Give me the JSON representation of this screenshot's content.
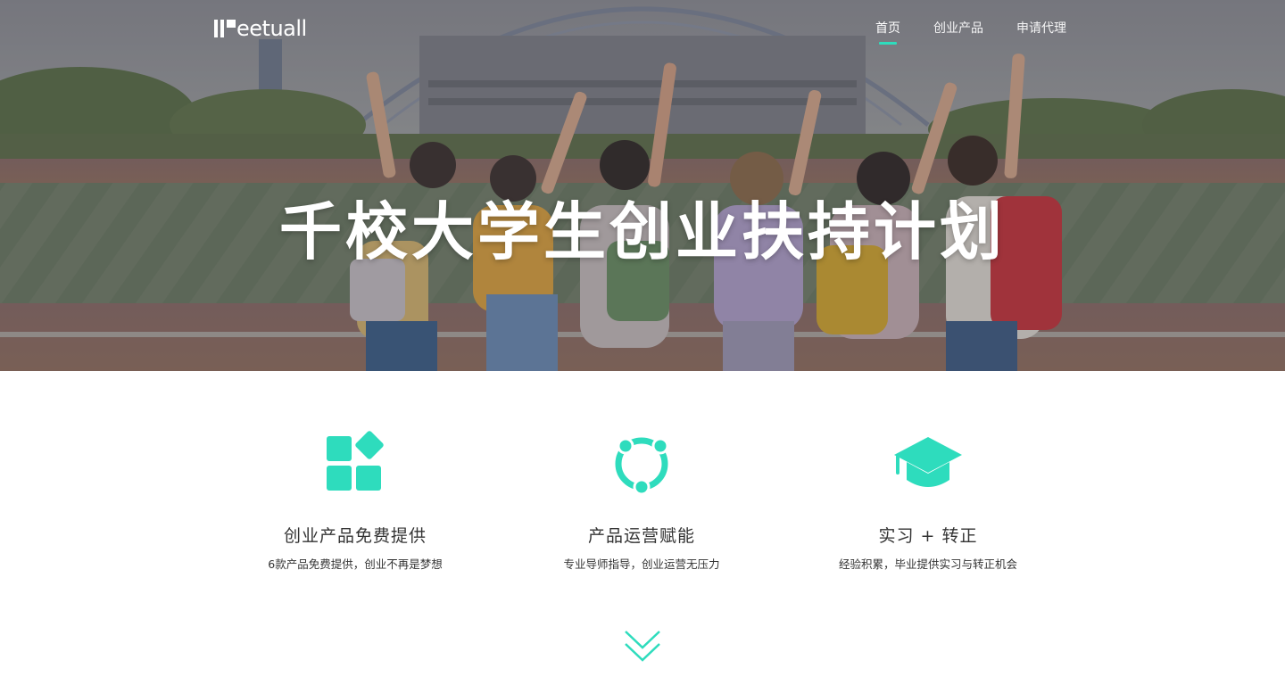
{
  "brand": {
    "name": "eetuall",
    "accent": "#2edcbd"
  },
  "nav": {
    "items": [
      {
        "label": "首页",
        "active": true
      },
      {
        "label": "创业产品",
        "active": false
      },
      {
        "label": "申请代理",
        "active": false
      }
    ]
  },
  "hero": {
    "title": "千校大学生创业扶持计划"
  },
  "features": [
    {
      "icon": "grid-blocks-icon",
      "title": "创业产品免费提供",
      "desc": "6款产品免费提供，创业不再是梦想"
    },
    {
      "icon": "cycle-nodes-icon",
      "title": "产品运营赋能",
      "desc": "专业导师指导，创业运营无压力"
    },
    {
      "icon": "graduation-cap-icon",
      "title": "实习 + 转正",
      "desc": "经验积累，毕业提供实习与转正机会"
    }
  ],
  "scroll": {
    "icon": "double-chevron-down-icon"
  }
}
